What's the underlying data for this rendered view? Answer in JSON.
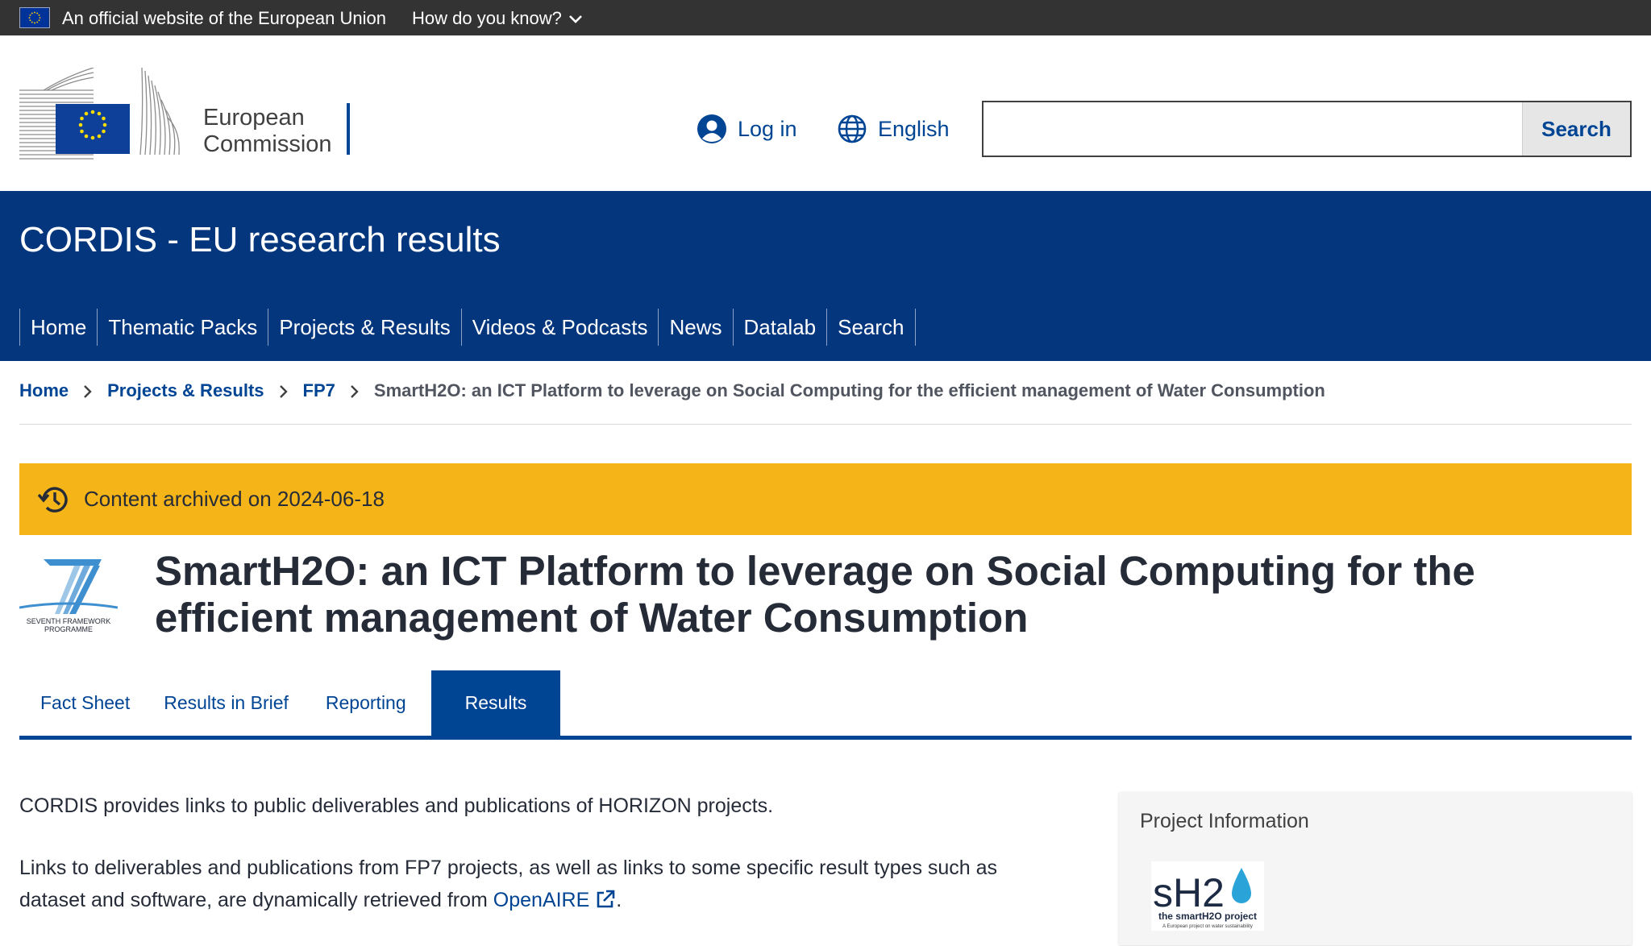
{
  "eu_bar": {
    "official_text": "An official website of the European Union",
    "how_know_text": "How do you know?"
  },
  "header": {
    "logo_line1": "European",
    "logo_line2": "Commission",
    "login_label": "Log in",
    "language_label": "English",
    "search_value": "",
    "search_button_label": "Search"
  },
  "site": {
    "title": "CORDIS - EU research results",
    "nav": [
      "Home",
      "Thematic Packs",
      "Projects & Results",
      "Videos & Podcasts",
      "News",
      "Datalab",
      "Search"
    ]
  },
  "breadcrumb": {
    "items": [
      "Home",
      "Projects & Results",
      "FP7"
    ],
    "current": "SmartH2O: an ICT Platform to leverage on Social Computing for the efficient management of Water Consumption"
  },
  "archived": {
    "text": "Content archived on 2024-06-18"
  },
  "project": {
    "fp7_logo_caption_1": "SEVENTH FRAMEWORK",
    "fp7_logo_caption_2": "PROGRAMME",
    "title": "SmartH2O: an ICT Platform to leverage on Social Computing for the efficient management of Water Consumption"
  },
  "tabs": {
    "items": [
      "Fact Sheet",
      "Results in Brief",
      "Reporting",
      "Results"
    ],
    "active": "Results"
  },
  "content": {
    "p1": "CORDIS provides links to public deliverables and publications of HORIZON projects.",
    "p2_before_link": "Links to deliverables and publications from FP7 projects, as well as links to some specific result types such as dataset and software, are dynamically retrieved from ",
    "p2_link": "OpenAIRE",
    "p2_after_link": "."
  },
  "side_panel": {
    "title": "Project Information",
    "logo_text": "sH2",
    "logo_caption": "the smartH2O project",
    "logo_subcaption": "A European project on water sustainability"
  },
  "colors": {
    "eu_bar_bg": "#333333",
    "banner_bg": "#04367d",
    "accent_blue": "#004494",
    "archived_bg": "#f5b518"
  }
}
